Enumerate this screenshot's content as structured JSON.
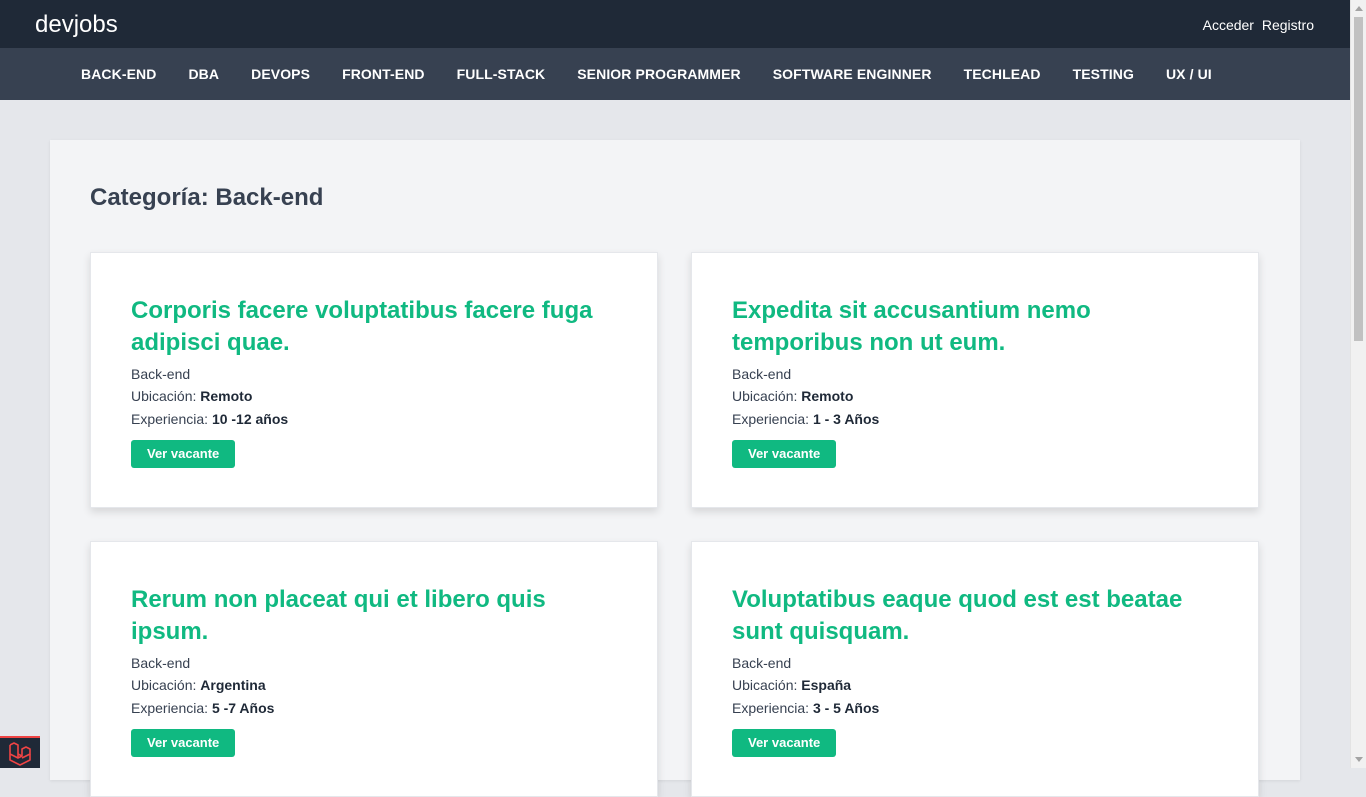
{
  "header": {
    "brand": "devjobs",
    "login": "Acceder",
    "register": "Registro"
  },
  "categories": [
    "Back-end",
    "DBA",
    "DevOps",
    "Front-end",
    "Full-Stack",
    "Senior Programmer",
    "Software Enginner",
    "TechLead",
    "Testing",
    "UX / UI"
  ],
  "page": {
    "title_prefix": "Categoría:",
    "category": "Back-end"
  },
  "labels": {
    "location": "Ubicación:",
    "experience": "Experiencia:",
    "button": "Ver vacante"
  },
  "jobs": [
    {
      "title": "Corporis facere voluptatibus facere fuga adipisci quae.",
      "category": "Back-end",
      "location": "Remoto",
      "experience": "10 -12 años"
    },
    {
      "title": "Expedita sit accusantium nemo temporibus non ut eum.",
      "category": "Back-end",
      "location": "Remoto",
      "experience": "1 - 3 Años"
    },
    {
      "title": "Rerum non placeat qui et libero quis ipsum.",
      "category": "Back-end",
      "location": "Argentina",
      "experience": "5 -7 Años"
    },
    {
      "title": "Voluptatibus eaque quod est est beatae sunt quisquam.",
      "category": "Back-end",
      "location": "España",
      "experience": "3 - 5 Años"
    }
  ],
  "colors": {
    "accent": "#10b981",
    "topbar": "#1f2937",
    "navbar": "#374151"
  },
  "icons": {
    "corner_badge": "laravel-logo-icon"
  }
}
